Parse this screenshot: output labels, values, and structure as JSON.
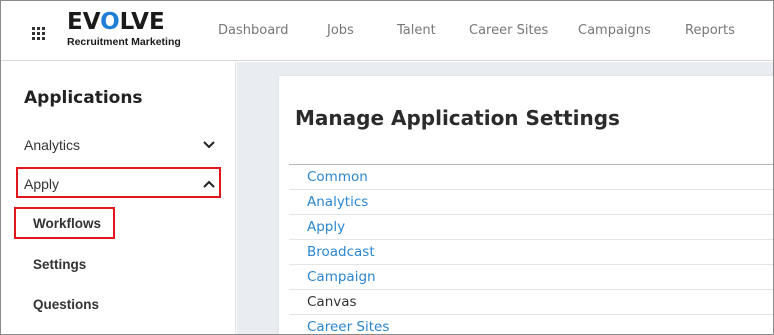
{
  "brand": {
    "name_part1": "EV",
    "name_o": "O",
    "name_part2": "LVE",
    "subtitle": "Recruitment Marketing"
  },
  "nav": {
    "items": [
      "Dashboard",
      "Jobs",
      "Talent",
      "Career Sites",
      "Campaigns",
      "Reports"
    ]
  },
  "sidebar": {
    "title": "Applications",
    "sections": [
      {
        "label": "Analytics",
        "state": "collapsed",
        "icon": "chevron-down-icon"
      },
      {
        "label": "Apply",
        "state": "expanded",
        "icon": "chevron-up-icon",
        "highlighted": true
      }
    ],
    "sub_items": [
      {
        "label": "Workflows",
        "highlighted": true
      },
      {
        "label": "Settings"
      },
      {
        "label": "Questions"
      }
    ]
  },
  "main": {
    "title": "Manage Application Settings",
    "links": [
      {
        "label": "Common",
        "link": true
      },
      {
        "label": "Analytics",
        "link": true
      },
      {
        "label": "Apply",
        "link": true
      },
      {
        "label": "Broadcast",
        "link": true
      },
      {
        "label": "Campaign",
        "link": true
      },
      {
        "label": "Canvas",
        "link": false
      },
      {
        "label": "Career Sites",
        "link": true
      }
    ]
  },
  "colors": {
    "accent_blue": "#2a86d1",
    "highlight_red": "#e0161b",
    "main_background": "#e9edf1"
  }
}
